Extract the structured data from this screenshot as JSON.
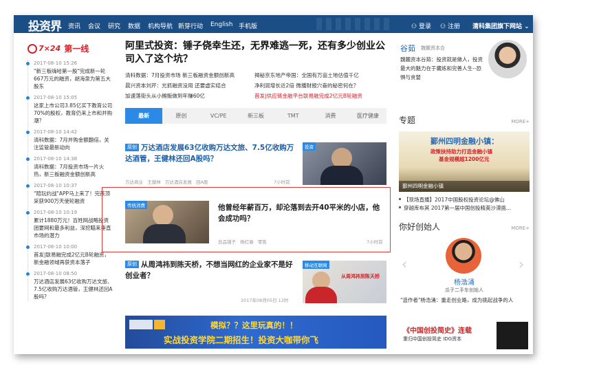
{
  "nav": {
    "logo": "投资界",
    "logo_sub": "PEdaily.cn",
    "items": [
      "资讯",
      "会议",
      "研究",
      "数据",
      "机构导航",
      "新芽行动",
      "English",
      "手机版"
    ],
    "login": "登录",
    "register": "注册",
    "group": "清科集团旗下网站"
  },
  "live": {
    "title": "第一线",
    "prefix": "7×24",
    "items": [
      {
        "time": "2017-08-10 15:26",
        "text": "\"新三板嗨哈第一股\"完成新一轮667万元的融资，胡海泉为第五大股东"
      },
      {
        "time": "2017-08-10 15:05",
        "text": "这家上市公司3.85亿买下教育公司70%的股权，教育仍来上市和并购潮？"
      },
      {
        "time": "2017-08-10 14:42",
        "text": "清科数据：7月并购金额翻倍，关注监管最新动向"
      },
      {
        "time": "2017-08-10 14:38",
        "text": "清科数据：7月投资市场一片火热，新三板融资金额创新高"
      },
      {
        "time": "2017-08-10 10:37",
        "text": "\"陪玩约战\"APP马上来了！完孩顶采获900万天使轮融资"
      },
      {
        "time": "2017-08-10 10:19",
        "text": "累计1880万元！百姓网战略投资团要网和最多利益，深挖瞄来垂直市场的潜力"
      },
      {
        "time": "2017-08-10 10:00",
        "text": "首发|联易融完成2亿元B轮融资，新金融领域再获资本落子"
      },
      {
        "time": "2017-08-10 08:50",
        "text": "万达酒店发展63亿收购万达文旅、7.5亿收购万达酒管，王健林还回A股吗？"
      }
    ]
  },
  "main": {
    "headline": "阿里式投资：锤子侥幸生还，无界难逃一死，还有多少创业公司入了这个坑？",
    "sub_links": [
      {
        "text": "清科数据：7月投资市场 新三板融资金额创新高",
        "red": false
      },
      {
        "text": "揭秘京东地产帝国：全国有万亩土地估值千亿",
        "red": false
      },
      {
        "text": "晨兴资本刘芹：光抓融资没用 还要虚实结合",
        "red": false
      },
      {
        "text": "净利润增长近2倍 微播财报穴奋的秘密何在？",
        "red": false
      },
      {
        "text": "加速落街头从小摊贩做到年赚60亿",
        "red": false
      },
      {
        "text": "首发|供应链金融平台联易融完成2亿元B轮融资",
        "red": true
      }
    ],
    "tabs": [
      "最新",
      "原创",
      "VC/PE",
      "新三板",
      "TMT",
      "消费",
      "医疗健康"
    ],
    "articles": [
      {
        "tag": "原创",
        "title": "万达酒店发展63亿收购万达文旅、7.5亿收购万达酒管，王健林还回A股吗？",
        "meta": [
          "万达商业",
          "王健林",
          "万达酒店发展",
          "回A股"
        ],
        "time": "7小时前",
        "thumb_tag": "投资"
      },
      {
        "tag": "",
        "title": "他曾经年薪百万，却沦落到去开40平米的小店，他会成功吗？",
        "meta": [
          "良品铺子",
          "杨红春",
          "零售"
        ],
        "time": "7小时前",
        "thumb_tag": "传统消费"
      },
      {
        "tag": "原创",
        "title": "从周鸿祎到陈天桥，不想当网红的企业家不是好创业者？",
        "meta": [],
        "time": "2017年08月05日 12时",
        "thumb_tag": "移动互联网",
        "thumb_text": "从周鸿祎到陈天桥"
      }
    ],
    "banner": {
      "line1": "模拟？？这里玩真的！！",
      "line2": "实战投资学院二期招生！投资大咖带你飞"
    }
  },
  "right": {
    "profile": {
      "name": "谷茹",
      "role": "魏麓资本合",
      "quote": "魏麓资本谷茹：投资就是做人，投资最大的魅力在于藏练和完善人生--恐惧与贪婪"
    },
    "special": {
      "title": "专题",
      "more": "MORE+",
      "banner_text": "鄞州四明金融小镇：",
      "banner_sub": "政策扶持助力打造金融小镇",
      "banner_sub2": "基金规模超1200亿元",
      "caption": "鄞州四明金融小镇"
    },
    "links": [
      "【现场直播】2017中国股权投资论坛@佛山",
      "穿越库布其 2017第一届中国创投精英沙漠挑..."
    ],
    "founder": {
      "title": "你好创始人",
      "more": "MORE+",
      "name": "杨浩涌",
      "role": "瓜子二手车创始人",
      "quote": "\"造作者\"杨浩涌：重走创业路，成为挑起战争的人"
    },
    "book": {
      "title": "《中国创投简史》连载",
      "sub": "重归中国创投简史 IDG资本"
    }
  }
}
